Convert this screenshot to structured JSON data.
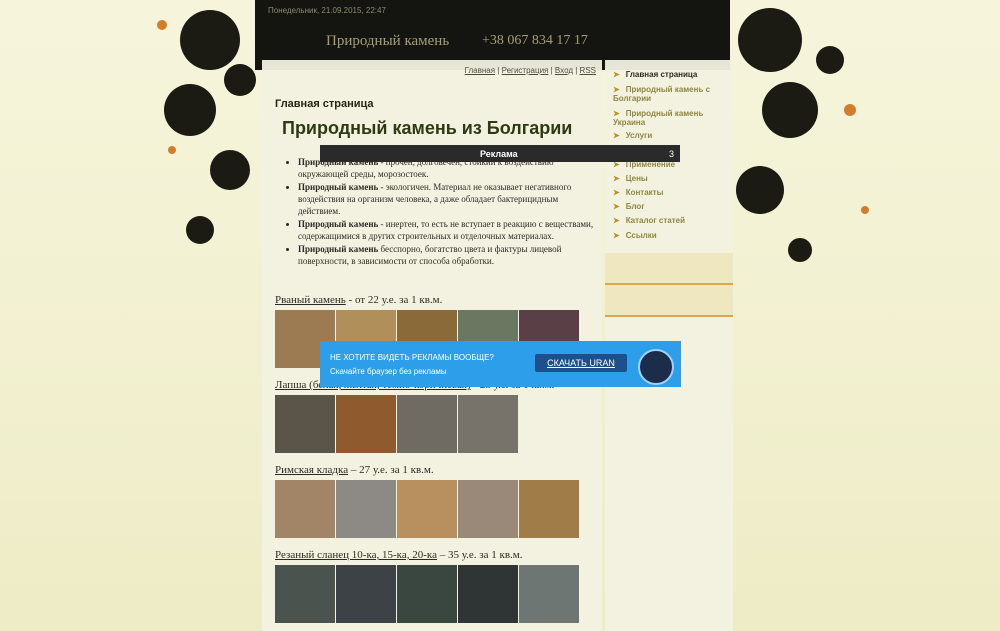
{
  "header": {
    "date": "Понедельник, 21.09.2015, 22:47",
    "title": "Природный камень",
    "phone": "+38 067 834 17 17"
  },
  "top_links": [
    "Главная",
    "Регистрация",
    "Вход",
    "RSS"
  ],
  "page_heading": "Главная страница",
  "main_title": "Природный камень из Болгарии",
  "bullets": [
    {
      "bold": "Природный камень",
      "text": " - прочен, долговечен, стойкий к воздействию окружающей среды, морозостоек."
    },
    {
      "bold": "Природный камень",
      "text": " - экологичен. Материал не оказывает негативного воздействия на организм человека, а даже обладает бактерицидным действием."
    },
    {
      "bold": "Природный камень",
      "text": " - инертен, то есть не вступает в реакцию с веществами, содержащимися в других строительных и отделочных материалах."
    },
    {
      "bold": "Природный камень",
      "text": " бесспорно, богатство цвета и фактуры лицевой поверхности, в зависимости от способа обработки."
    }
  ],
  "sections": [
    {
      "name": "Рваный камень",
      "rest": " - от 22 у.е. за 1 кв.м."
    },
    {
      "name": "Лапша (белая, желтая, темно-коричневая)",
      "rest": " - 25 у.е. за 1 кв.м."
    },
    {
      "name": "Римская кладка",
      "rest": " – 27 у.е. за 1 кв.м."
    },
    {
      "name": "Резаный сланец 10-ка, 15-ка, 20-ка",
      "rest": " – 35 у.е. за 1 кв.м."
    }
  ],
  "nav": [
    {
      "label": "Главная страница",
      "active": true
    },
    {
      "label": "Природный камень с Болгарии",
      "active": false
    },
    {
      "label": "Природный камень Украина",
      "active": false
    },
    {
      "label": "Услуги",
      "active": false
    },
    {
      "label": "Применение",
      "active": false
    },
    {
      "label": "Цены",
      "active": false
    },
    {
      "label": "Контакты",
      "active": false
    },
    {
      "label": "Блог",
      "active": false
    },
    {
      "label": "Каталог статей",
      "active": false
    },
    {
      "label": "Ссылки",
      "active": false
    }
  ],
  "ad": {
    "label": "Реклама",
    "countdown": "3",
    "banner_head": "НЕ ХОТИТЕ ВИДЕТЬ РЕКЛАМЫ ВООБЩЕ?",
    "banner_sub": "Скачайте браузер без рекламы",
    "button": "СКАЧАТЬ URAN"
  },
  "colors": {
    "accent": "#b8941d",
    "ad_blue": "#2d9fea",
    "header_bg": "#141410"
  }
}
